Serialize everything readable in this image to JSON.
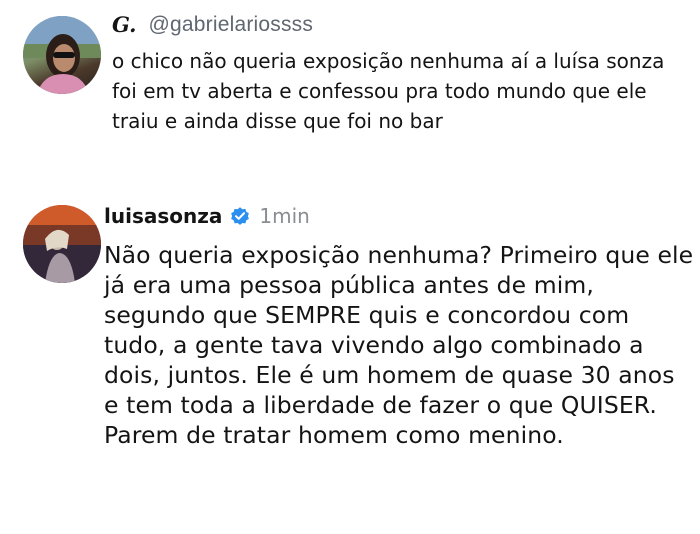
{
  "tweet": {
    "display_name": "G.",
    "handle": "@gabrielariossss",
    "text": "o chico não queria exposição nenhuma aí a luísa sonza foi em tv aberta e confessou pra todo mundo que ele traiu e ainda disse que foi no bar",
    "avatar_icon": "profile-photo-icon"
  },
  "reply": {
    "username": "luisasonza",
    "verified_icon": "verified-badge-icon",
    "verified_color": "#2b8ff0",
    "time": "1min",
    "text": "Não queria exposição nenhuma? Primeiro que ele já era uma pessoa pública antes de mim, segundo que SEMPRE quis e concordou com tudo, a gente tava vivendo algo combinado a dois, juntos. Ele é um homem de quase 30 anos e tem toda a liberdade de fazer o que QUISER. Parem de tratar homem como menino.",
    "avatar_icon": "profile-photo-icon"
  }
}
